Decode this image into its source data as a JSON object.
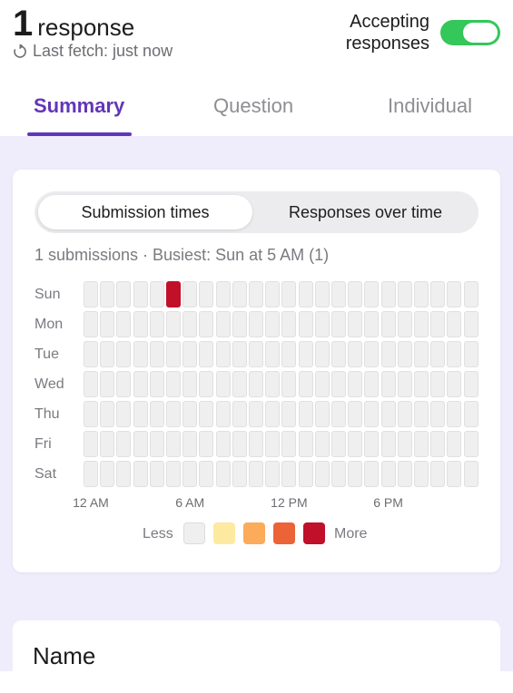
{
  "header": {
    "response_count": "1",
    "response_label": "response",
    "last_fetch": "Last fetch: just now",
    "accepting_label": "Accepting responses",
    "accepting_on": true
  },
  "tabs": [
    {
      "label": "Summary",
      "active": true
    },
    {
      "label": "Question",
      "active": false
    },
    {
      "label": "Individual",
      "active": false
    }
  ],
  "card": {
    "segments": [
      {
        "label": "Submission times",
        "active": true
      },
      {
        "label": "Responses over time",
        "active": false
      }
    ],
    "stats": "1 submissions  ·  Busiest: Sun at 5 AM (1)",
    "heatmap": {
      "days": [
        "Sun",
        "Mon",
        "Tue",
        "Wed",
        "Thu",
        "Fri",
        "Sat"
      ],
      "hour_labels": [
        "12 AM",
        "6 AM",
        "12 PM",
        "6 PM"
      ],
      "hours": 24,
      "filled": [
        {
          "day": "Sun",
          "hour": 5,
          "count": 1
        }
      ]
    },
    "legend": {
      "less": "Less",
      "more": "More",
      "colors": [
        "#efefef",
        "#fde9a0",
        "#fbab5a",
        "#ec6338",
        "#c0102a"
      ]
    }
  },
  "section": {
    "title": "Name"
  },
  "colors": {
    "accent": "#6236b8",
    "toggle_on": "#34c759",
    "background": "#efedfb"
  }
}
